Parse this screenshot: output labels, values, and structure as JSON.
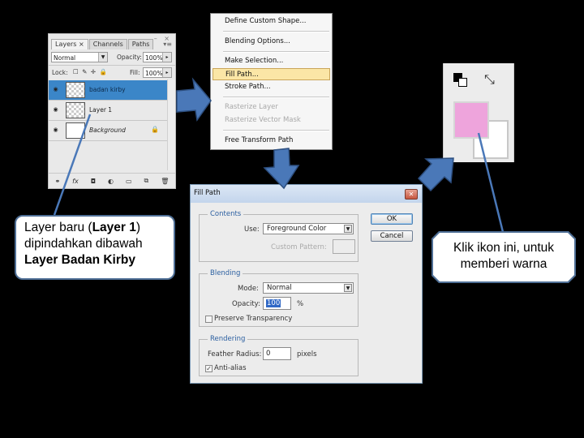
{
  "layers_panel": {
    "tabs": [
      {
        "label": "Layers ×",
        "active": true
      },
      {
        "label": "Channels",
        "active": false
      },
      {
        "label": "Paths",
        "active": false
      }
    ],
    "window_controls": "– ×",
    "menu_icon": "▾≡",
    "blend_mode": "Normal",
    "opacity_label": "Opacity:",
    "opacity_value": "100%",
    "lock_label": "Lock:",
    "lock_icons": "☐ ✎ ✛ 🔒",
    "fill_label": "Fill:",
    "fill_value": "100%",
    "layers": [
      {
        "name": "badan kirby",
        "selected": true,
        "thumb": "transparent",
        "locked": false
      },
      {
        "name": "Layer 1",
        "selected": false,
        "thumb": "transparent",
        "locked": false
      },
      {
        "name": "Background",
        "selected": false,
        "thumb": "white",
        "locked": true
      }
    ],
    "bottom_icons": [
      "link-icon",
      "fx-icon",
      "mask-icon",
      "adjustment-icon",
      "group-icon",
      "new-layer-icon",
      "trash-icon"
    ],
    "bottom_glyphs": [
      "⚭",
      "fx",
      "◘",
      "◐",
      "▭",
      "⧉",
      "🗑"
    ]
  },
  "context_menu": {
    "items": [
      {
        "label": "Define Custom Shape...",
        "disabled": false,
        "highlight": false
      },
      {
        "label": "Blending Options...",
        "disabled": false,
        "highlight": false
      },
      {
        "label": "Make Selection...",
        "disabled": false,
        "highlight": false
      },
      {
        "label": "Fill Path...",
        "disabled": false,
        "highlight": true
      },
      {
        "label": "Stroke Path...",
        "disabled": false,
        "highlight": false
      },
      {
        "label": "Rasterize Layer",
        "disabled": true,
        "highlight": false
      },
      {
        "label": "Rasterize Vector Mask",
        "disabled": true,
        "highlight": false
      },
      {
        "label": "Free Transform Path",
        "disabled": false,
        "highlight": false
      }
    ]
  },
  "color_swatches": {
    "foreground_color": "#eea4dc",
    "background_color": "#ffffff",
    "swap_glyph": "⤡",
    "default_colors_label": "default-colors-icon"
  },
  "fill_path_dialog": {
    "title": "Fill Path",
    "close_glyph": "✕",
    "ok_label": "OK",
    "cancel_label": "Cancel",
    "contents": {
      "legend": "Contents",
      "use_label": "Use:",
      "use_value": "Foreground Color",
      "custom_pattern_label": "Custom Pattern:"
    },
    "blending": {
      "legend": "Blending",
      "mode_label": "Mode:",
      "mode_value": "Normal",
      "opacity_label": "Opacity:",
      "opacity_value": "100",
      "opacity_unit": "%",
      "preserve_transparency_label": "Preserve Transparency",
      "preserve_transparency_checked": false
    },
    "rendering": {
      "legend": "Rendering",
      "feather_label": "Feather Radius:",
      "feather_value": "0",
      "feather_unit": "pixels",
      "antialias_label": "Anti-alias",
      "antialias_checked": true
    }
  },
  "callouts": {
    "left": {
      "part1": "Layer baru (",
      "part2": "Layer 1",
      "part3": ")",
      "line2": "dipindahkan dibawah",
      "line3": "Layer Badan Kirby"
    },
    "right": {
      "line1": "Klik ikon ini, untuk",
      "line2": "memberi warna"
    }
  },
  "colors": {
    "arrow_fill": "#4a78b8",
    "arrow_stroke": "#2d4f80",
    "callout_border": "#4f6f96",
    "selection_blue": "#3b86c8",
    "menu_highlight": "#fbe6a6"
  }
}
